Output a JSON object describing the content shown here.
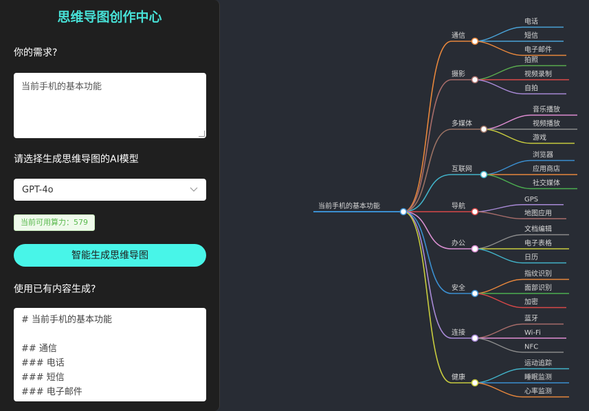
{
  "sidebar": {
    "title": "思维导图创作中心",
    "need_label": "你的需求?",
    "need_value": "当前手机的基本功能",
    "model_label": "请选择生成思维导图的AI模型",
    "model_value": "GPT-4o",
    "quota_text": "当前可用算力：579",
    "generate_label": "智能生成思维导图",
    "existing_label": "使用已有内容生成?",
    "markdown_lines": [
      "# 当前手机的基本功能",
      "",
      "## 通信",
      "### 电话",
      "### 短信",
      "### 电子邮件"
    ]
  },
  "mindmap": {
    "root": "当前手机的基本功能",
    "branches": [
      {
        "label": "通信",
        "color": "#e8873c",
        "children": [
          {
            "label": "电话",
            "color": "#4aa3d8"
          },
          {
            "label": "短信",
            "color": "#4aa3d8"
          },
          {
            "label": "电子邮件",
            "color": "#e8873c"
          }
        ]
      },
      {
        "label": "摄影",
        "color": "#a86d6a",
        "children": [
          {
            "label": "拍照",
            "color": "#5aab4e"
          },
          {
            "label": "视频录制",
            "color": "#d84848"
          },
          {
            "label": "自拍",
            "color": "#a98ad7"
          }
        ]
      },
      {
        "label": "多媒体",
        "color": "#9a7163",
        "children": [
          {
            "label": "音乐播放",
            "color": "#e18ed4"
          },
          {
            "label": "视频播放",
            "color": "#8b8b8b"
          },
          {
            "label": "游戏",
            "color": "#c8cc3e"
          }
        ]
      },
      {
        "label": "互联网",
        "color": "#42b3c9",
        "children": [
          {
            "label": "浏览器",
            "color": "#3b8fd0"
          },
          {
            "label": "应用商店",
            "color": "#e8873c"
          },
          {
            "label": "社交媒体",
            "color": "#4caf50"
          }
        ]
      },
      {
        "label": "导航",
        "color": "#d84848",
        "children": [
          {
            "label": "GPS",
            "color": "#a98ad7"
          },
          {
            "label": "地图应用",
            "color": "#a86d6a"
          }
        ]
      },
      {
        "label": "办公",
        "color": "#d98fd1",
        "children": [
          {
            "label": "文档编辑",
            "color": "#8b8b8b"
          },
          {
            "label": "电子表格",
            "color": "#c8cc3e"
          },
          {
            "label": "日历",
            "color": "#42b3c9"
          }
        ]
      },
      {
        "label": "安全",
        "color": "#3b8fd0",
        "children": [
          {
            "label": "指纹识别",
            "color": "#e8873c"
          },
          {
            "label": "面部识别",
            "color": "#4caf50"
          },
          {
            "label": "加密",
            "color": "#d84848"
          }
        ]
      },
      {
        "label": "连接",
        "color": "#a98ad7",
        "children": [
          {
            "label": "蓝牙",
            "color": "#a86d6a"
          },
          {
            "label": "Wi-Fi",
            "color": "#e18ed4"
          },
          {
            "label": "NFC",
            "color": "#8b8b8b"
          }
        ]
      },
      {
        "label": "健康",
        "color": "#c8cc3e",
        "children": [
          {
            "label": "运动追踪",
            "color": "#42b3c9"
          },
          {
            "label": "睡眠监测",
            "color": "#3b8fd0"
          },
          {
            "label": "心率监测",
            "color": "#e8873c"
          }
        ]
      }
    ]
  }
}
